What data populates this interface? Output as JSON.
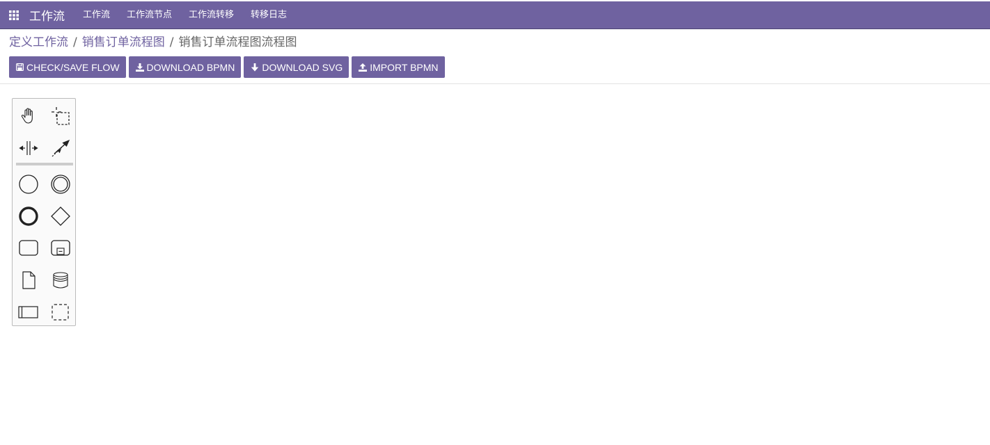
{
  "navbar": {
    "app_title": "工作流",
    "menu": [
      "工作流",
      "工作流节点",
      "工作流转移",
      "转移日志"
    ],
    "background_color": "#6f62a0"
  },
  "breadcrumb": {
    "items": [
      "定义工作流",
      "销售订单流程图"
    ],
    "current": "销售订单流程图流程图",
    "separator": "/"
  },
  "toolbar": {
    "check_save": {
      "label": "CHECK/SAVE FLOW",
      "icon": "save-icon"
    },
    "download_bpmn": {
      "label": "DOWNLOAD BPMN",
      "icon": "download-icon"
    },
    "download_svg": {
      "label": "DOWNLOAD SVG",
      "icon": "arrow-down-icon"
    },
    "import_bpmn": {
      "label": "IMPORT BPMN",
      "icon": "upload-icon"
    }
  },
  "palette": {
    "tools": [
      "hand-tool-icon",
      "lasso-tool-icon",
      "space-tool-icon",
      "global-connect-tool-icon",
      "start-event-icon",
      "intermediate-event-icon",
      "end-event-icon",
      "gateway-icon",
      "task-icon",
      "subprocess-icon",
      "data-object-icon",
      "data-store-icon",
      "participant-pool-icon",
      "group-icon"
    ]
  }
}
